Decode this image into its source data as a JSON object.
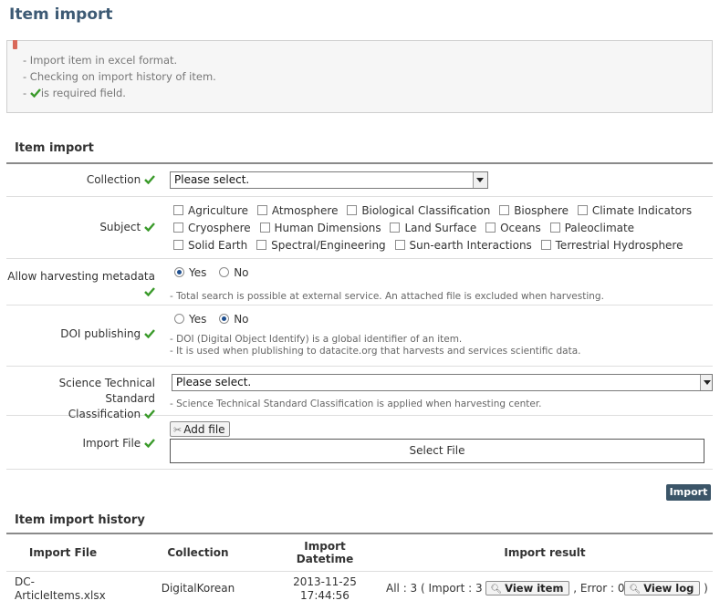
{
  "page_title": "Item import",
  "notice": {
    "lines": [
      "- Import item in excel format.",
      "- Checking on import history of item."
    ],
    "required_prefix": "- ",
    "required_text": "is required field."
  },
  "form": {
    "section_title": "Item import",
    "collection": {
      "label": "Collection",
      "value": "Please select."
    },
    "subject": {
      "label": "Subject",
      "row1": [
        "Agriculture",
        "Atmosphere",
        "Biological Classification",
        "Biosphere",
        "Climate Indicators"
      ],
      "row2": [
        "Cryosphere",
        "Human Dimensions",
        "Land Surface",
        "Oceans",
        "Paleoclimate"
      ],
      "row3": [
        "Solid Earth",
        "Spectral/Engineering",
        "Sun-earth Interactions",
        "Terrestrial Hydrosphere"
      ]
    },
    "harvesting": {
      "label": "Allow harvesting metadata",
      "yes": "Yes",
      "no": "No",
      "selected": "Yes",
      "help": "- Total search is possible at external service. An attached file is excluded when harvesting."
    },
    "doi": {
      "label": "DOI publishing",
      "yes": "Yes",
      "no": "No",
      "selected": "No",
      "help1": "- DOI (Digital Object Identify) is a global identifier of an item.",
      "help2": "- It is used when plublishing to datacite.org that harvests and services scientific data."
    },
    "standard": {
      "label_line1": "Science Technical Standard",
      "label_line2": "Classification",
      "value": "Please select.",
      "help": "- Science Technical Standard Classification is applied when harvesting center."
    },
    "import_file": {
      "label": "Import File",
      "add_button": "Add file",
      "select_text": "Select File"
    },
    "import_button": "Import"
  },
  "history": {
    "section_title": "Item import history",
    "headers": {
      "import_file": "Import File",
      "collection": "Collection",
      "datetime_line1": "Import",
      "datetime_line2": "Datetime",
      "result": "Import result"
    },
    "rows": [
      {
        "file_line1": "DC-",
        "file_line2": "ArticleItems.xlsx",
        "collection": "DigitalKorean",
        "date": "2013-11-25",
        "time": "17:44:56",
        "result_prefix": "All : 3 ( Import : 3",
        "view_item": "View item",
        "result_mid": ", Error : 0",
        "view_log": "View log",
        "result_suffix": ")"
      }
    ]
  },
  "colors": {
    "title": "#3d5a74",
    "check": "#3a9a2a",
    "import_button": "#3b5568"
  }
}
